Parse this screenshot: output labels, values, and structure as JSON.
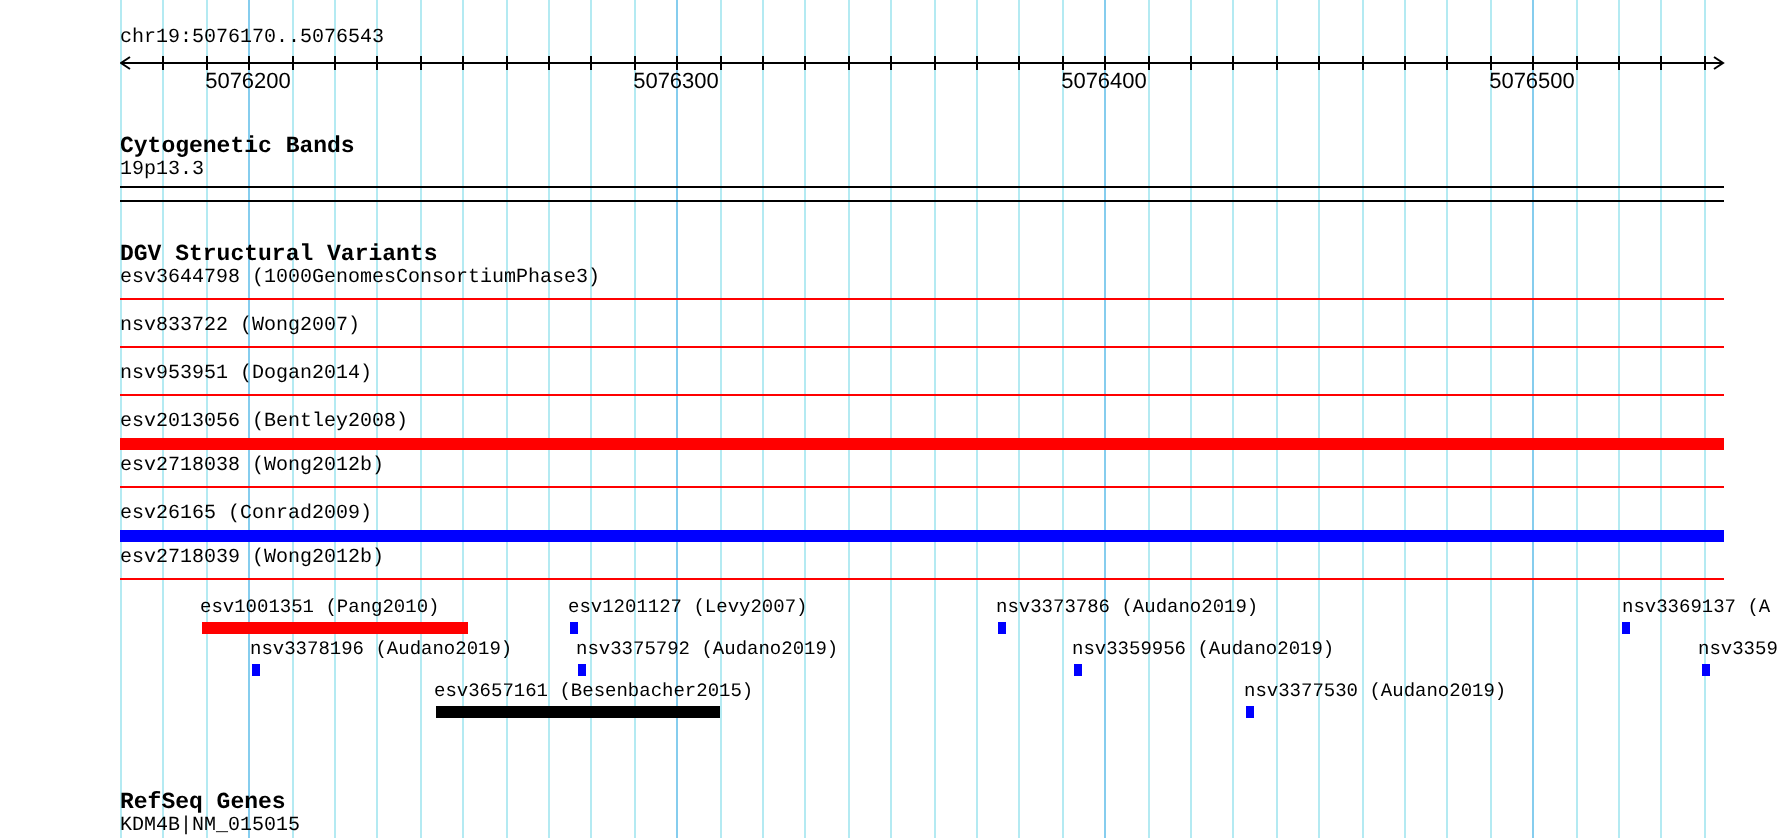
{
  "ruler": {
    "location": "chr19:5076170..5076543",
    "labels": [
      "5076200",
      "5076300",
      "5076400",
      "5076500"
    ]
  },
  "tracks": [
    {
      "kind": "bands",
      "title": "Cytogenetic Bands",
      "features": [
        {
          "label": "19p13.3"
        }
      ]
    },
    {
      "kind": "variants",
      "title": "DGV Structural Variants",
      "rows": [
        {
          "label": "esv3644798 (1000GenomesConsortiumPhase3)",
          "kind": "line",
          "color": "#ff0000"
        },
        {
          "label": "nsv833722 (Wong2007)",
          "kind": "line",
          "color": "#ff0000"
        },
        {
          "label": "nsv953951 (Dogan2014)",
          "kind": "line",
          "color": "#ff0000"
        },
        {
          "label": "esv2013056 (Bentley2008)",
          "kind": "bar",
          "color": "#ff0000"
        },
        {
          "label": "esv2718038 (Wong2012b)",
          "kind": "line",
          "color": "#ff0000"
        },
        {
          "label": "esv26165 (Conrad2009)",
          "kind": "bar",
          "color": "#0000ff"
        },
        {
          "label": "esv2718039 (Wong2012b)",
          "kind": "line",
          "color": "#ff0000"
        }
      ],
      "features": [
        {
          "label": "esv1001351 (Pang2010)",
          "color": "#ff0000"
        },
        {
          "label": "esv1201127 (Levy2007)",
          "color": "#0000ff"
        },
        {
          "label": "nsv3378196 (Audano2019)",
          "color": "#0000ff"
        },
        {
          "label": "nsv3375792 (Audano2019)",
          "color": "#0000ff"
        },
        {
          "label": "esv3657161 (Besenbacher2015)",
          "color": "#000000"
        },
        {
          "label": "nsv3373786 (Audano2019)",
          "color": "#0000ff"
        },
        {
          "label": "nsv3359956 (Audano2019)",
          "color": "#0000ff"
        },
        {
          "label": "nsv3377530 (Audano2019)",
          "color": "#0000ff"
        },
        {
          "label": "nsv3369137 (A",
          "color": "#0000ff"
        },
        {
          "label": "nsv3359",
          "color": "#0000ff"
        }
      ]
    },
    {
      "kind": "genes",
      "title": "RefSeq Genes",
      "features": [
        {
          "label": "KDM4B|NM_015015"
        }
      ]
    }
  ]
}
